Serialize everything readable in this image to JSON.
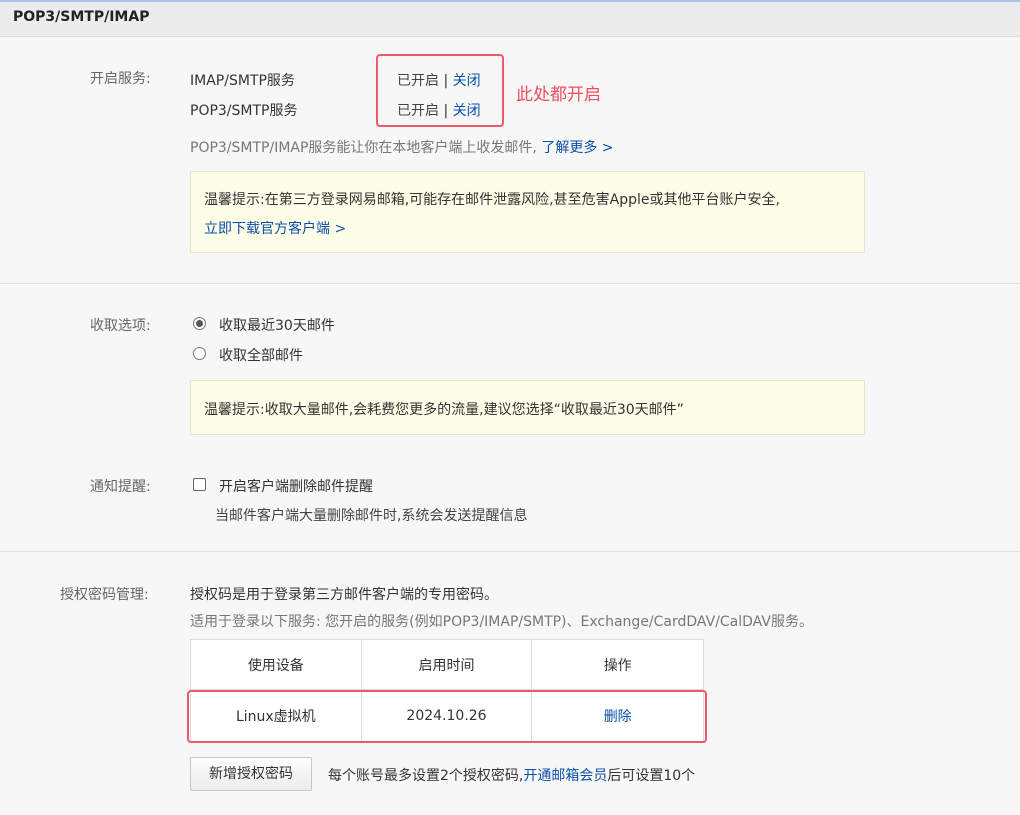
{
  "header": {
    "title": "POP3/SMTP/IMAP"
  },
  "services": {
    "label": "开启服务:",
    "items": [
      {
        "name": "IMAP/SMTP服务",
        "status": "已开启",
        "separator": "|",
        "action": "关闭"
      },
      {
        "name": "POP3/SMTP服务",
        "status": "已开启",
        "separator": "|",
        "action": "关闭"
      }
    ],
    "annotation": "此处都开启",
    "description": "POP3/SMTP/IMAP服务能让你在本地客户端上收发邮件,",
    "learn_more": "了解更多 >",
    "tip_line1": "温馨提示:在第三方登录网易邮箱,可能存在邮件泄露风险,甚至危害Apple或其他平台账户安全,",
    "tip_link": "立即下载官方客户端 >"
  },
  "fetch": {
    "label": "收取选项:",
    "options": [
      {
        "label": "收取最近30天邮件",
        "checked": true
      },
      {
        "label": "收取全部邮件",
        "checked": false
      }
    ],
    "tip": "温馨提示:收取大量邮件,会耗费您更多的流量,建议您选择“收取最近30天邮件”"
  },
  "notify": {
    "label": "通知提醒:",
    "checkbox_label": "开启客户端删除邮件提醒",
    "description": "当邮件客户端大量删除邮件时,系统会发送提醒信息"
  },
  "auth": {
    "label": "授权密码管理:",
    "line1": "授权码是用于登录第三方邮件客户端的专用密码。",
    "line2": "适用于登录以下服务: 您开启的服务(例如POP3/IMAP/SMTP)、Exchange/CardDAV/CalDAV服务。",
    "table_headers": [
      "使用设备",
      "启用时间",
      "操作"
    ],
    "rows": [
      {
        "device": "Linux虚拟机",
        "date": "2024.10.26",
        "action": "删除"
      }
    ],
    "new_button": "新增授权密码",
    "note_prefix": "每个账号最多设置2个授权密码,",
    "note_link": "开通邮箱会员",
    "note_suffix": "后可设置10个"
  },
  "colors": {
    "link": "#0b4fa8",
    "annotation": "#ee4d5f",
    "tip_bg": "#fdfde8"
  }
}
